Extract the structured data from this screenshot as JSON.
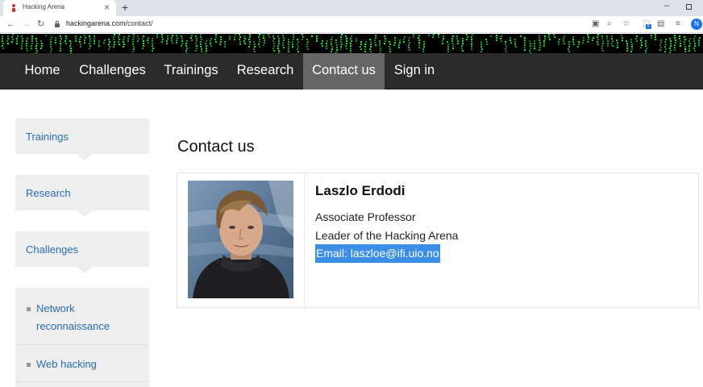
{
  "browser": {
    "tab_title": "Hacking Arena",
    "url_host": "hackingarena.com",
    "url_path": "/contact/",
    "profile_initial": "N",
    "ext_badge": "6"
  },
  "nav": {
    "items": [
      "Home",
      "Challenges",
      "Trainings",
      "Research",
      "Contact us",
      "Sign in"
    ],
    "active": "Contact us"
  },
  "sidebar": {
    "sections": [
      "Trainings",
      "Research",
      "Challenges"
    ],
    "sub_items": [
      "Network reconnaissance",
      "Web hacking"
    ]
  },
  "main": {
    "title": "Contact us",
    "person": {
      "name": "Laszlo Erdodi",
      "position": "Associate Professor",
      "role": "Leader of the Hacking Arena",
      "email": "Email: laszloe@ifi.uio.no"
    }
  },
  "colors": {
    "link": "#2a6db0",
    "nav_bg": "#2b2b2b",
    "nav_active": "#666666",
    "selection": "#3a8ee6"
  }
}
